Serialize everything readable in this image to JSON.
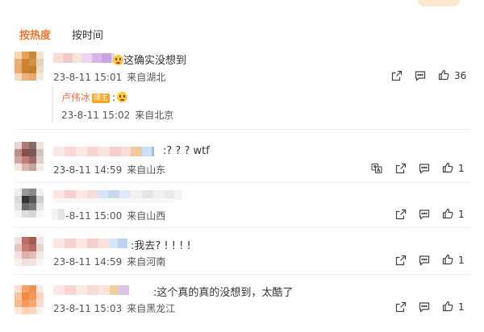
{
  "tabs": [
    {
      "label": "按热度",
      "active": true
    },
    {
      "label": "按时间",
      "active": false
    }
  ],
  "comments": [
    {
      "text": "这确实没想到",
      "time": "23-8-11 15:01",
      "location": "来自湖北",
      "likes": "36"
    },
    {
      "text": ":? ? ? wtf",
      "time": "23-8-11 14:59",
      "location": "来自山东",
      "likes": "1"
    },
    {
      "text": "",
      "time": "23-8-11 15:00",
      "location": "来自山西",
      "likes": "1"
    },
    {
      "text": ":我去? ! ! ! !",
      "time": "23-8-11 14:59",
      "location": "来自河南",
      "likes": "1"
    },
    {
      "text": ":这个真的真的没想到，太酷了",
      "time": "23-8-11 15:03",
      "location": "来自黑龙江",
      "likes": "1"
    }
  ],
  "reply": {
    "author": "卢伟冰",
    "badge": "博主",
    "text": ":",
    "time": "23-8-11 15:02",
    "location": "来自北京"
  },
  "colors": {
    "accent": "#e8792c",
    "reply_author": "#eb7350",
    "badge": "#f5a623"
  },
  "icons": [
    "share-icon",
    "comment-icon",
    "like-icon",
    "translate-icon"
  ]
}
